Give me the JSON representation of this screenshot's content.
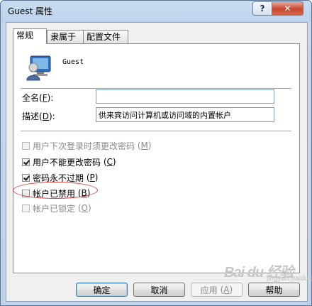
{
  "window": {
    "title": "Guest 属性",
    "help_label": "?",
    "close_label": "✕"
  },
  "tabs": [
    {
      "label": "常规",
      "active": true
    },
    {
      "label": "隶属于",
      "active": false
    },
    {
      "label": "配置文件",
      "active": false
    }
  ],
  "user": {
    "name": "Guest",
    "icon": "user-icon"
  },
  "fields": {
    "fullname": {
      "label": "全名",
      "accel": "F",
      "value": ""
    },
    "description": {
      "label": "描述",
      "accel": "D",
      "value": "供来宾访问计算机或访问域的内置帐户"
    }
  },
  "checkboxes": [
    {
      "label": "用户下次登录时须更改密码",
      "accel": "M",
      "checked": false,
      "enabled": false
    },
    {
      "label": "用户不能更改密码",
      "accel": "C",
      "checked": true,
      "enabled": true
    },
    {
      "label": "密码永不过期",
      "accel": "P",
      "checked": true,
      "enabled": true
    },
    {
      "label": "帐户已禁用",
      "accel": "B",
      "checked": false,
      "enabled": true
    },
    {
      "label": "帐户已锁定",
      "accel": "O",
      "checked": false,
      "enabled": false
    }
  ],
  "buttons": {
    "ok": "确定",
    "cancel": "取消",
    "apply": {
      "label": "应用",
      "accel": "A"
    },
    "help": "帮助"
  },
  "watermark": {
    "brand": "Bai du 经验",
    "url": "jingyan.baidu.com"
  },
  "colors": {
    "highlight_ellipse": "#d9413a",
    "field_border": "#7a9cc0"
  }
}
